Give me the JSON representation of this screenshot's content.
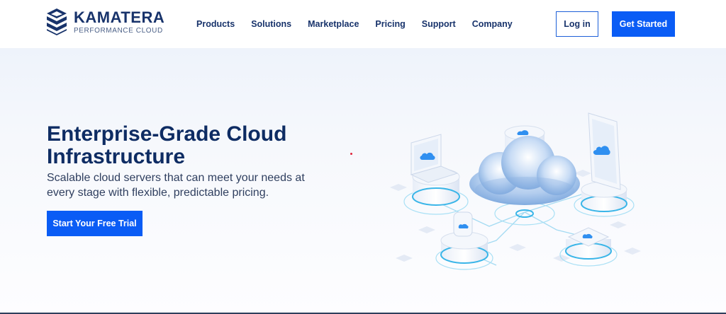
{
  "brand": {
    "name": "KAMATERA",
    "tagline": "PERFORMANCE CLOUD"
  },
  "nav": {
    "items": [
      {
        "label": "Products"
      },
      {
        "label": "Solutions"
      },
      {
        "label": "Marketplace"
      },
      {
        "label": "Pricing"
      },
      {
        "label": "Support"
      },
      {
        "label": "Company"
      }
    ]
  },
  "header": {
    "login_label": "Log in",
    "get_started_label": "Get Started"
  },
  "hero": {
    "title": "Enterprise-Grade Cloud Infrastructure",
    "subtitle": "Scalable cloud servers that can meet your needs at every stage with flexible, predictable pricing.",
    "cta_label": "Start Your Free Trial"
  },
  "icons": {
    "logo": "kamatera-logo-icon",
    "illustration": "cloud-infrastructure-illustration",
    "cloud": "cloud-icon"
  },
  "colors": {
    "brand_navy": "#18336b",
    "primary_blue": "#0a5cf5",
    "title_navy": "#0e2c63",
    "cloud_blue": "#2f8ff0"
  }
}
